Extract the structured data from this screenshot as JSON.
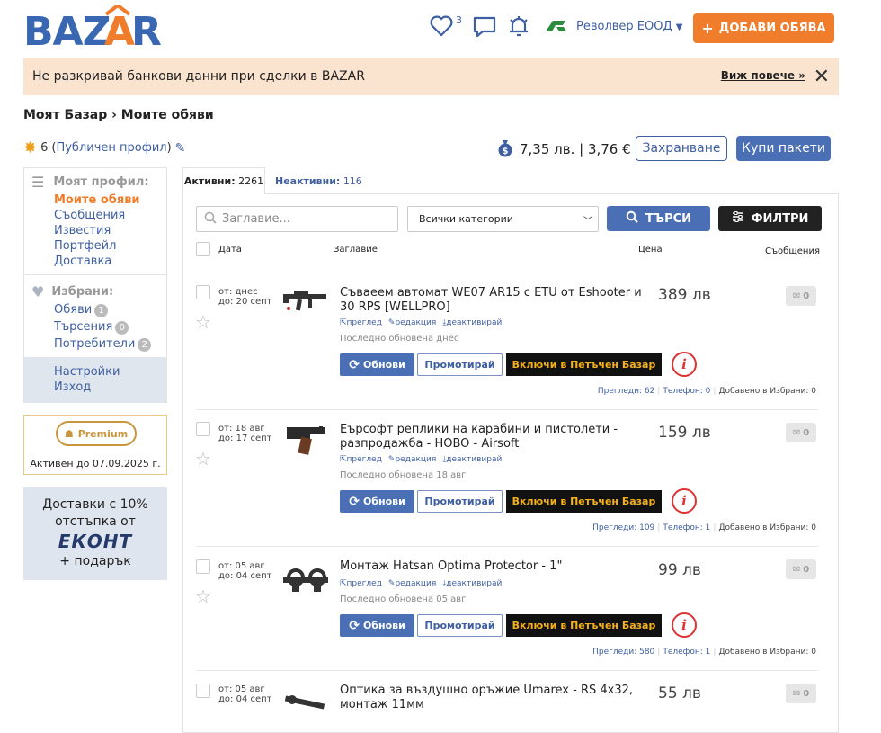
{
  "header": {
    "logo_text": "BAZAR",
    "favorites_count": "3",
    "account_name": "Револвер ЕООД",
    "add_listing_label": "ДОБАВИ ОБЯВА"
  },
  "banner": {
    "text": "Не разкривай банкови данни при сделки в BAZAR",
    "more_label": "Виж повече »"
  },
  "breadcrumb": "Моят Базар › Моите обяви",
  "rating": {
    "count": "6",
    "public_profile": "Публичен профил"
  },
  "balance": {
    "text": "7,35 лв. | 3,76 €",
    "save_label": "Захранване",
    "buy_label": "Купи пакети"
  },
  "sidebar": {
    "profile_heading": "Моят профил:",
    "profile_items": [
      "Моите обяви",
      "Съобщения",
      "Известия",
      "Портфейл",
      "Доставка"
    ],
    "favorites_heading": "Избрани:",
    "favorites_items": [
      {
        "label": "Обяви",
        "count": "1"
      },
      {
        "label": "Търсения",
        "count": "0"
      },
      {
        "label": "Потребители",
        "count": "2"
      }
    ],
    "settings": "Настройки",
    "logout": "Изход"
  },
  "premium": {
    "label": "Premium",
    "until": "Активен до 07.09.2025 г."
  },
  "econt": {
    "line1": "Доставки с 10%",
    "line2": "отстъпка от",
    "logo": "ЕКОНТ",
    "line3": "+ подарък"
  },
  "tabs": {
    "active_label": "Активни:",
    "active_count": "2261",
    "inactive_label": "Неактивни:",
    "inactive_count": "116"
  },
  "search": {
    "placeholder": "Заглавие...",
    "category": "Всички категории",
    "search_label": "ТЪРСИ",
    "filters_label": "ФИЛТРИ"
  },
  "columns": {
    "date": "Дата",
    "title": "Заглавие",
    "price": "Цена",
    "messages": "Съобщения"
  },
  "actions": {
    "preview": "преглед",
    "edit": "редакция",
    "deactivate": "деактивирай",
    "update": "Обнови",
    "promote": "Промотирай",
    "friday": "Включи в Петъчен Базар",
    "views": "Прегледи:",
    "phone": "Телефон:",
    "fav_added": "Добавено в Избрани:"
  },
  "listings": [
    {
      "from": "от: днес",
      "to": "до: 20 септ",
      "title": "Съваеем автомат WE07 AR15 с ETU от Eshooter и 30 RPS [WELLPRO]",
      "price": "389 лв",
      "messages": "0",
      "updated": "Последно обновена днес",
      "views": "62",
      "phone": "0",
      "favs": "0"
    },
    {
      "from": "от: 18 авг",
      "to": "до: 17 септ",
      "title": "Еърсофт реплики на карабини и пистолети - разпродажба - HOBO - Airsoft",
      "price": "159 лв",
      "messages": "0",
      "updated": "Последно обновена 18 авг",
      "views": "109",
      "phone": "1",
      "favs": "0"
    },
    {
      "from": "от: 05 авг",
      "to": "до: 04 септ",
      "title": "Монтаж Hatsan Optima Protector - 1\"",
      "price": "99 лв",
      "messages": "0",
      "updated": "Последно обновена 05 авг",
      "views": "580",
      "phone": "1",
      "favs": "0"
    },
    {
      "from": "от: 05 авг",
      "to": "до: 04 септ",
      "title": "Оптика за въздушно оръжие Umarex - RS 4x32, монтаж 11мм",
      "price": "55 лв",
      "messages": "0",
      "updated": "",
      "views": "",
      "phone": "",
      "favs": ""
    }
  ],
  "colors": {
    "accent_orange": "#ef7d2c",
    "primary_blue": "#4a6fb5",
    "link_blue": "#3f5fa3",
    "banner_bg": "#fbe4cf"
  }
}
